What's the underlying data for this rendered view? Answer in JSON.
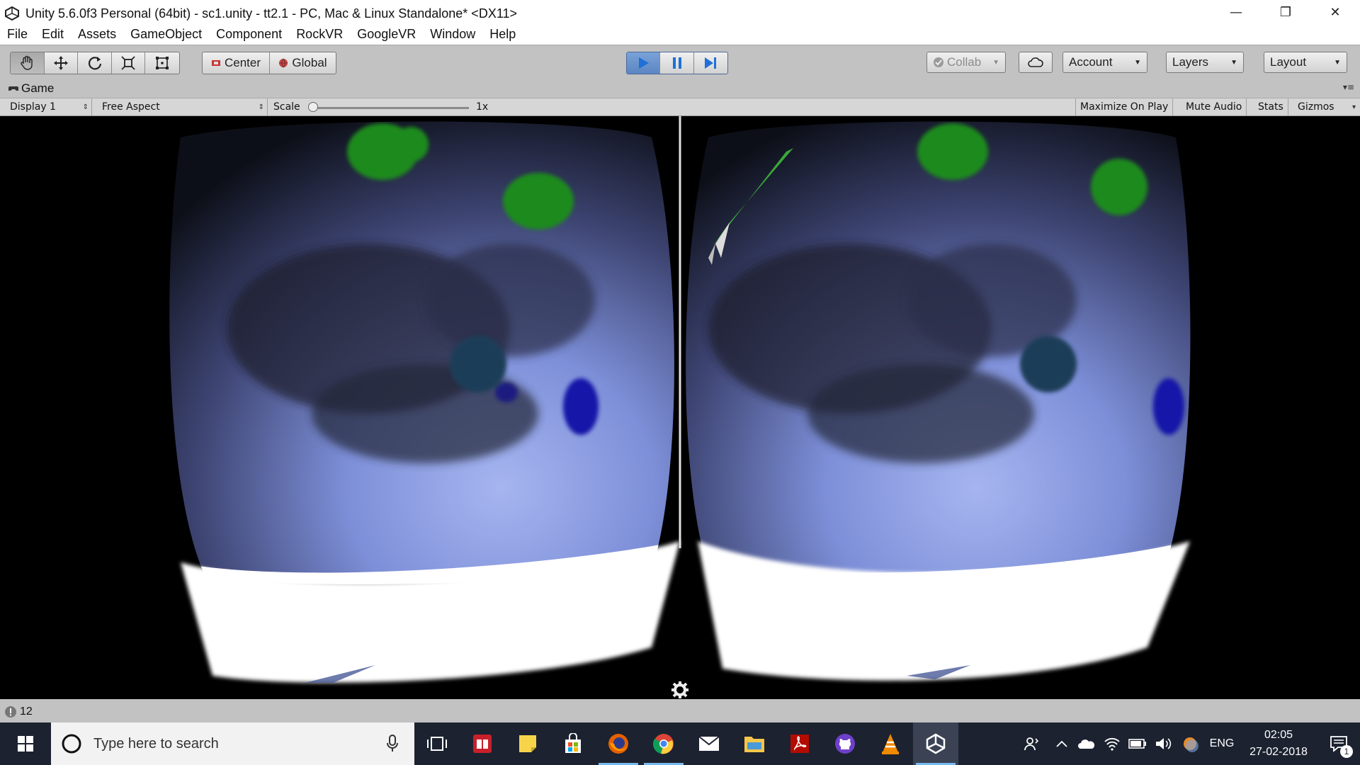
{
  "window": {
    "title": "Unity 5.6.0f3 Personal (64bit) - sc1.unity - tt2.1 - PC, Mac & Linux Standalone* <DX11>",
    "minimize": "—",
    "restore": "❐",
    "close": "✕"
  },
  "menu": [
    "File",
    "Edit",
    "Assets",
    "GameObject",
    "Component",
    "RockVR",
    "GoogleVR",
    "Window",
    "Help"
  ],
  "toolbar": {
    "pivot": "Center",
    "space": "Global",
    "collab": "Collab",
    "account": "Account",
    "layers": "Layers",
    "layout": "Layout"
  },
  "game_view": {
    "tab": "Game",
    "display": "Display 1",
    "aspect": "Free Aspect",
    "scale_label": "Scale",
    "scale_value": "1x",
    "maximize": "Maximize On Play",
    "mute": "Mute Audio",
    "stats": "Stats",
    "gizmos": "Gizmos"
  },
  "status": {
    "warning_count": "12"
  },
  "taskbar": {
    "search_placeholder": "Type here to search",
    "lang": "ENG",
    "time": "02:05",
    "date": "27-02-2018",
    "notif_count": "1"
  },
  "colors": {
    "play_blue": "#1f6fd6",
    "taskbar_bg": "#1c2230",
    "sky_blue": "#7d8fd8",
    "panel_gray": "#c2c2c2"
  }
}
